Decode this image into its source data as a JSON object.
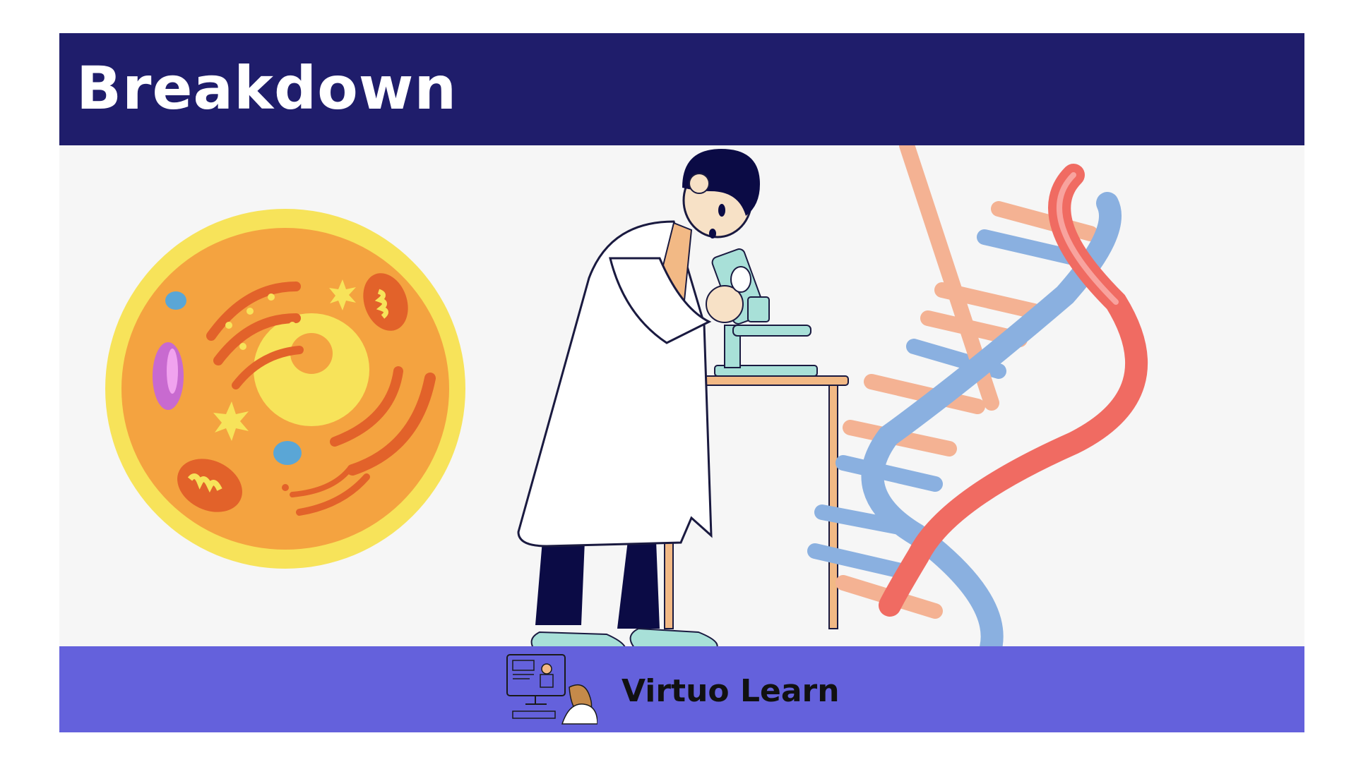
{
  "slide": {
    "title": "Breakdown",
    "brand_name": "Virtuo Learn",
    "colors": {
      "header_bg": "#1f1d6b",
      "stage_bg": "#f6f6f6",
      "footer_bg": "#6461dc",
      "title_text": "#ffffff",
      "brand_text": "#111111"
    },
    "illustrations": [
      "cell-illustration",
      "scientist-with-microscope-illustration",
      "dna-double-helix-illustration"
    ],
    "logo_icon": "online-learning-icon"
  }
}
